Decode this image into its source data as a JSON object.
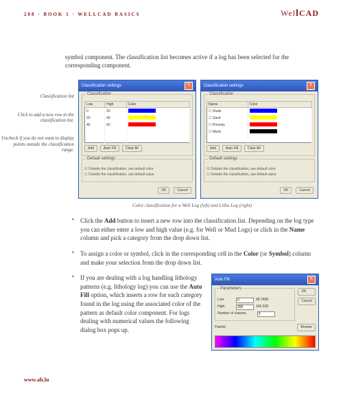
{
  "header": {
    "crumb": "208 · BOOK 1 · WELLCAD BASICS",
    "brand_part1": "Wel",
    "brand_bar": "l",
    "brand_part2": "CAD"
  },
  "intro": "symbol component. The classification list becomes active if a log has been selected for the corresponding component.",
  "labels": {
    "list": "Classification list",
    "add": "Click to add a new row to the classification list.",
    "uncheck": "Uncheck if you do not want to display points outside the classification range."
  },
  "dlgA": {
    "title": "Classification settings",
    "close": "X",
    "group": "Classification",
    "cols": {
      "low": "Low",
      "high": "High",
      "color": "Color"
    },
    "rows": [
      {
        "low": "0",
        "high": "20",
        "color": "#0000ff"
      },
      {
        "low": "20",
        "high": "40",
        "color": "#ffff00"
      },
      {
        "low": "40",
        "high": "60",
        "color": "#ff0000"
      }
    ],
    "add": "Add",
    "autofill": "Auto Fill",
    "clearall": "Clear All",
    "default": "Default settings",
    "cb1": "Outside the classification, use default color",
    "cb2": "Outside the classification, use default value",
    "ok": "OK",
    "cancel": "Cancel"
  },
  "dlgB": {
    "title": "Classification settings",
    "group": "Classification",
    "cols": {
      "name": "Name",
      "color": "Color"
    },
    "rows": [
      {
        "name": "Shale",
        "color": "#0000ff"
      },
      {
        "name": "Sand",
        "color": "#ffff00"
      },
      {
        "name": "Porosity",
        "color": "#ff0000"
      },
      {
        "name": "Marls",
        "color": "#000000"
      }
    ]
  },
  "caption": "Color classification for a Well Log (left) and Litho Log (right)",
  "bul1_a": "Click the ",
  "bul1_add": "Add",
  "bul1_b": " button to insert a new row into the classification list. Depending on the log type you can either enter a low and high value (e.g. for Well or Mud Logs) or click in the ",
  "bul1_name": "Name",
  "bul1_c": " column and pick a category from the drop down list.",
  "bul2_a": "To assign a color or symbol, click in the corresponding cell in the ",
  "bul2_color": "Color",
  "bul2_b": " (or ",
  "bul2_symbol": "Symbol",
  "bul2_c": ") column and make your selection from the drop down list.",
  "bul3_a": "If you are dealing with a log handling lithology patterns (e.g. lithology log) you can use the ",
  "bul3_af": "Auto Fill",
  "bul3_b": " option, which inserts a row for each category found in the log using the associated color of the pattern as default color component. For logs dealing with numerical values the following dialog box pops up.",
  "autofill": {
    "title": "Auto Fill",
    "params": "Parameters",
    "low_l": "Low:",
    "low_v": "0",
    "low_e": "99.7458",
    "high_l": "High:",
    "high_v": "200",
    "high_e": "166.528",
    "n_l": "Number of classes:",
    "n_v": "5",
    "ok": "OK",
    "cancel": "Cancel",
    "palette": "Palette:",
    "browse": "Browse"
  },
  "footer": "www.alt.lu"
}
